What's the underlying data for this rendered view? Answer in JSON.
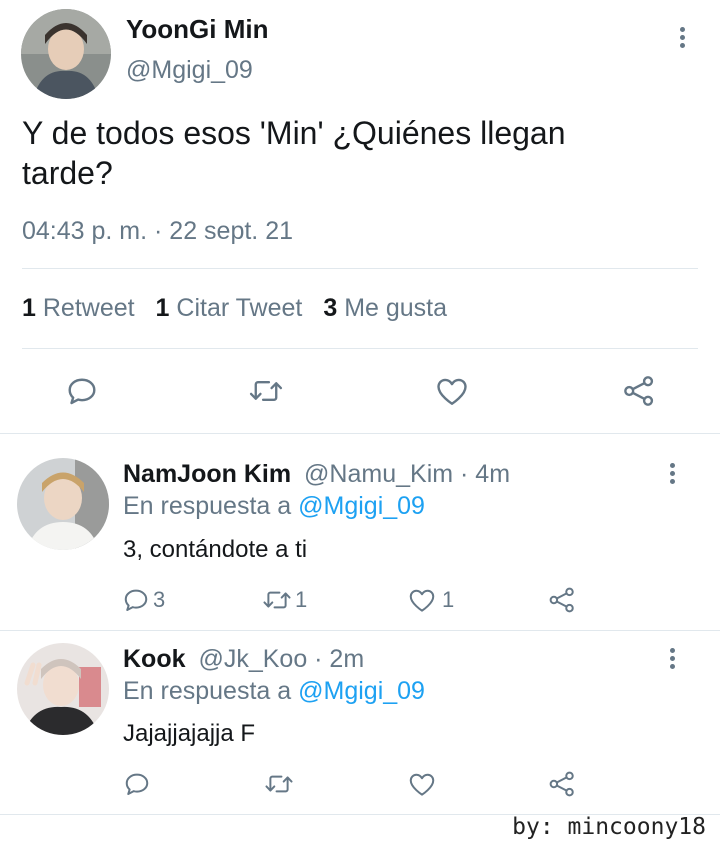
{
  "main_tweet": {
    "display_name": "YoonGi Min",
    "handle": "@Mgigi_09",
    "text": "Y de todos esos 'Min' ¿Quiénes llegan tarde?",
    "timestamp": "04:43 p. m. · 22 sept. 21",
    "stats": {
      "retweets_count": "1",
      "retweets_label": "Retweet",
      "quotes_count": "1",
      "quotes_label": "Citar Tweet",
      "likes_count": "3",
      "likes_label": "Me gusta"
    },
    "actions": [
      "reply-icon",
      "retweet-icon",
      "like-icon",
      "share-icon"
    ]
  },
  "replies": [
    {
      "display_name": "NamJoon Kim",
      "handle_time": "@Namu_Kim · 4m",
      "reply_prefix": "En respuesta a",
      "reply_to": "@Mgigi_09",
      "text": "3, contándote a ti",
      "reply_count": "3",
      "retweet_count": "1",
      "like_count": "1"
    },
    {
      "display_name": "Kook",
      "handle_time": "@Jk_Koo · 2m",
      "reply_prefix": "En respuesta a",
      "reply_to": "@Mgigi_09",
      "text": "Jajajjajajja F",
      "reply_count": "",
      "retweet_count": "",
      "like_count": ""
    }
  ],
  "watermark": "by: mincoony18",
  "colors": {
    "text": "#14171a",
    "muted": "#657786",
    "link": "#1da1f2",
    "divider": "#e1e8ed"
  }
}
